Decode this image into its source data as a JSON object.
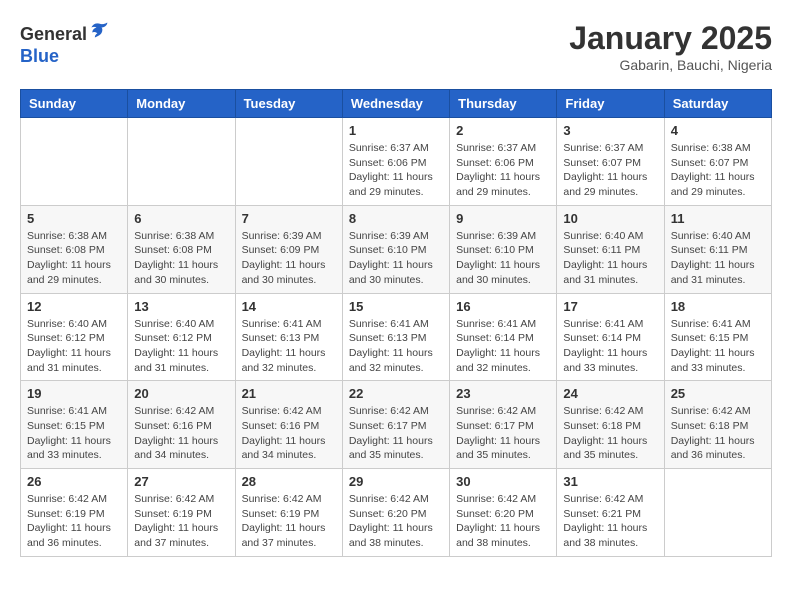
{
  "header": {
    "logo_line1": "General",
    "logo_line2": "Blue",
    "month_title": "January 2025",
    "location": "Gabarin, Bauchi, Nigeria"
  },
  "days_of_week": [
    "Sunday",
    "Monday",
    "Tuesday",
    "Wednesday",
    "Thursday",
    "Friday",
    "Saturday"
  ],
  "weeks": [
    [
      {
        "day": "",
        "info": ""
      },
      {
        "day": "",
        "info": ""
      },
      {
        "day": "",
        "info": ""
      },
      {
        "day": "1",
        "info": "Sunrise: 6:37 AM\nSunset: 6:06 PM\nDaylight: 11 hours and 29 minutes."
      },
      {
        "day": "2",
        "info": "Sunrise: 6:37 AM\nSunset: 6:06 PM\nDaylight: 11 hours and 29 minutes."
      },
      {
        "day": "3",
        "info": "Sunrise: 6:37 AM\nSunset: 6:07 PM\nDaylight: 11 hours and 29 minutes."
      },
      {
        "day": "4",
        "info": "Sunrise: 6:38 AM\nSunset: 6:07 PM\nDaylight: 11 hours and 29 minutes."
      }
    ],
    [
      {
        "day": "5",
        "info": "Sunrise: 6:38 AM\nSunset: 6:08 PM\nDaylight: 11 hours and 29 minutes."
      },
      {
        "day": "6",
        "info": "Sunrise: 6:38 AM\nSunset: 6:08 PM\nDaylight: 11 hours and 30 minutes."
      },
      {
        "day": "7",
        "info": "Sunrise: 6:39 AM\nSunset: 6:09 PM\nDaylight: 11 hours and 30 minutes."
      },
      {
        "day": "8",
        "info": "Sunrise: 6:39 AM\nSunset: 6:10 PM\nDaylight: 11 hours and 30 minutes."
      },
      {
        "day": "9",
        "info": "Sunrise: 6:39 AM\nSunset: 6:10 PM\nDaylight: 11 hours and 30 minutes."
      },
      {
        "day": "10",
        "info": "Sunrise: 6:40 AM\nSunset: 6:11 PM\nDaylight: 11 hours and 31 minutes."
      },
      {
        "day": "11",
        "info": "Sunrise: 6:40 AM\nSunset: 6:11 PM\nDaylight: 11 hours and 31 minutes."
      }
    ],
    [
      {
        "day": "12",
        "info": "Sunrise: 6:40 AM\nSunset: 6:12 PM\nDaylight: 11 hours and 31 minutes."
      },
      {
        "day": "13",
        "info": "Sunrise: 6:40 AM\nSunset: 6:12 PM\nDaylight: 11 hours and 31 minutes."
      },
      {
        "day": "14",
        "info": "Sunrise: 6:41 AM\nSunset: 6:13 PM\nDaylight: 11 hours and 32 minutes."
      },
      {
        "day": "15",
        "info": "Sunrise: 6:41 AM\nSunset: 6:13 PM\nDaylight: 11 hours and 32 minutes."
      },
      {
        "day": "16",
        "info": "Sunrise: 6:41 AM\nSunset: 6:14 PM\nDaylight: 11 hours and 32 minutes."
      },
      {
        "day": "17",
        "info": "Sunrise: 6:41 AM\nSunset: 6:14 PM\nDaylight: 11 hours and 33 minutes."
      },
      {
        "day": "18",
        "info": "Sunrise: 6:41 AM\nSunset: 6:15 PM\nDaylight: 11 hours and 33 minutes."
      }
    ],
    [
      {
        "day": "19",
        "info": "Sunrise: 6:41 AM\nSunset: 6:15 PM\nDaylight: 11 hours and 33 minutes."
      },
      {
        "day": "20",
        "info": "Sunrise: 6:42 AM\nSunset: 6:16 PM\nDaylight: 11 hours and 34 minutes."
      },
      {
        "day": "21",
        "info": "Sunrise: 6:42 AM\nSunset: 6:16 PM\nDaylight: 11 hours and 34 minutes."
      },
      {
        "day": "22",
        "info": "Sunrise: 6:42 AM\nSunset: 6:17 PM\nDaylight: 11 hours and 35 minutes."
      },
      {
        "day": "23",
        "info": "Sunrise: 6:42 AM\nSunset: 6:17 PM\nDaylight: 11 hours and 35 minutes."
      },
      {
        "day": "24",
        "info": "Sunrise: 6:42 AM\nSunset: 6:18 PM\nDaylight: 11 hours and 35 minutes."
      },
      {
        "day": "25",
        "info": "Sunrise: 6:42 AM\nSunset: 6:18 PM\nDaylight: 11 hours and 36 minutes."
      }
    ],
    [
      {
        "day": "26",
        "info": "Sunrise: 6:42 AM\nSunset: 6:19 PM\nDaylight: 11 hours and 36 minutes."
      },
      {
        "day": "27",
        "info": "Sunrise: 6:42 AM\nSunset: 6:19 PM\nDaylight: 11 hours and 37 minutes."
      },
      {
        "day": "28",
        "info": "Sunrise: 6:42 AM\nSunset: 6:19 PM\nDaylight: 11 hours and 37 minutes."
      },
      {
        "day": "29",
        "info": "Sunrise: 6:42 AM\nSunset: 6:20 PM\nDaylight: 11 hours and 38 minutes."
      },
      {
        "day": "30",
        "info": "Sunrise: 6:42 AM\nSunset: 6:20 PM\nDaylight: 11 hours and 38 minutes."
      },
      {
        "day": "31",
        "info": "Sunrise: 6:42 AM\nSunset: 6:21 PM\nDaylight: 11 hours and 38 minutes."
      },
      {
        "day": "",
        "info": ""
      }
    ]
  ]
}
